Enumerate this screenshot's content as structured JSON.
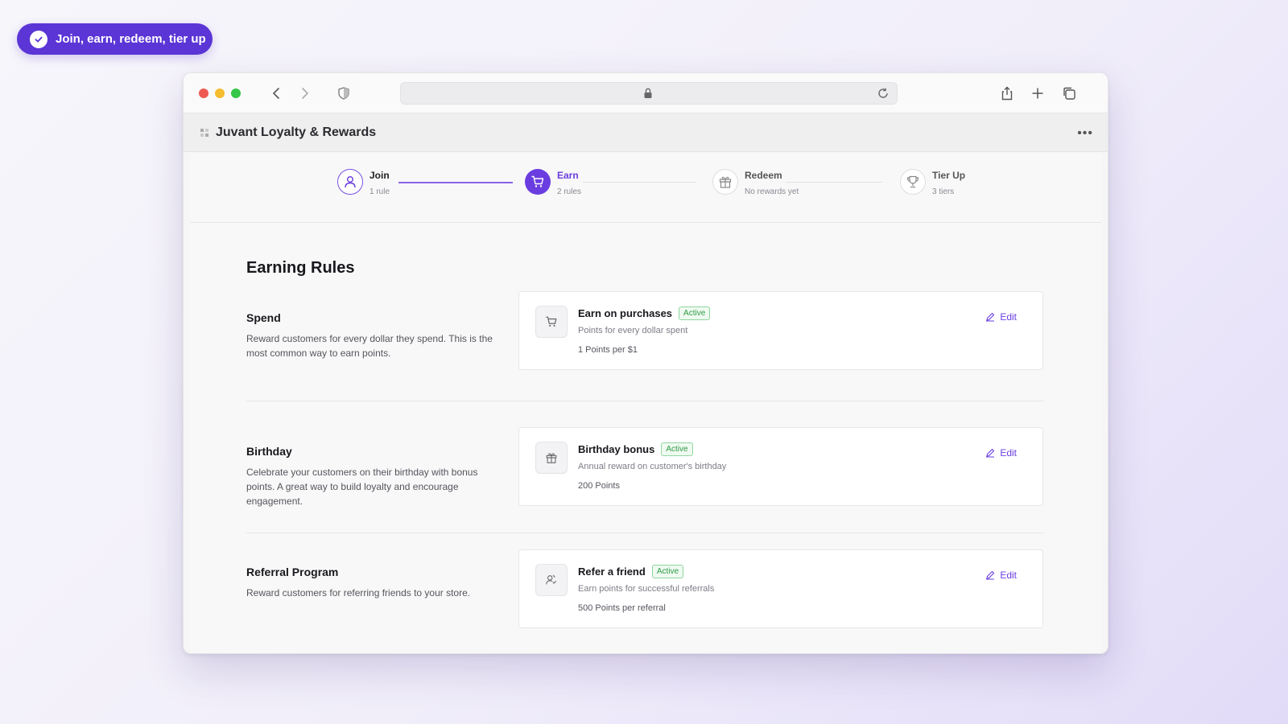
{
  "pill": {
    "label": "Join, earn, redeem, tier up"
  },
  "tab": {
    "title": "Juvant Loyalty & Rewards"
  },
  "stepper": [
    {
      "name": "Join",
      "sub": "1 rule",
      "state": "complete",
      "icon": "user-icon"
    },
    {
      "name": "Earn",
      "sub": "2 rules",
      "state": "active",
      "icon": "cart-icon"
    },
    {
      "name": "Redeem",
      "sub": "No rewards yet",
      "state": "upcoming",
      "icon": "gift-icon"
    },
    {
      "name": "Tier Up",
      "sub": "3 tiers",
      "state": "upcoming",
      "icon": "trophy-icon"
    }
  ],
  "main": {
    "title": "Earning Rules",
    "rules": [
      {
        "title": "Spend",
        "description": "Reward customers for every dollar they spend. This is the most common way to earn points.",
        "card": {
          "title": "Earn on purchases",
          "status": "Active",
          "subtitle": "Points for every dollar spent",
          "value": "1 Points per $1",
          "edit": "Edit",
          "icon": "cart-icon"
        }
      },
      {
        "title": "Birthday",
        "description": "Celebrate your customers on their birthday with bonus points. A great way to build loyalty and encourage engagement.",
        "card": {
          "title": "Birthday bonus",
          "status": "Active",
          "subtitle": "Annual reward on customer's birthday",
          "value": "200 Points",
          "edit": "Edit",
          "icon": "gift-icon"
        }
      },
      {
        "title": "Referral Program",
        "description": "Reward customers for referring friends to your store.",
        "card": {
          "title": "Refer a friend",
          "status": "Active",
          "subtitle": "Earn points for successful referrals",
          "value": "500 Points per referral",
          "edit": "Edit",
          "icon": "referral-icon"
        }
      }
    ]
  },
  "colors": {
    "accent": "#6a3de0",
    "pill": "#5b35d5",
    "active_badge": "#2f9b45"
  }
}
